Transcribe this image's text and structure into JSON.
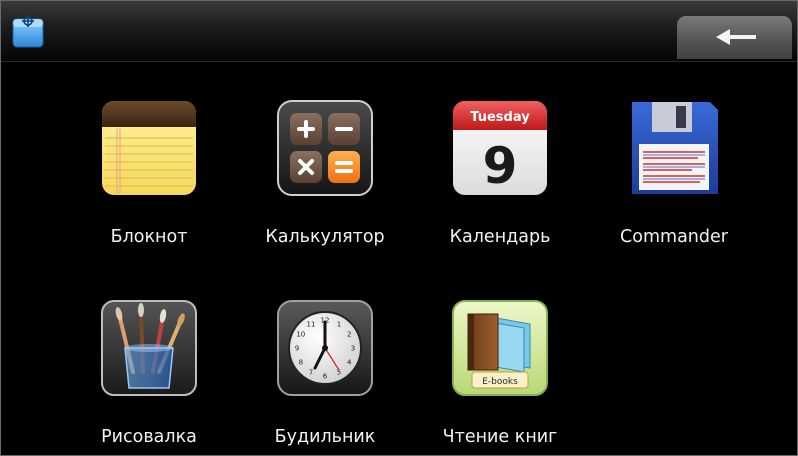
{
  "topbar": {
    "status_icon": "ship-wheel-icon",
    "back_icon": "back-arrow-icon"
  },
  "apps": [
    {
      "label": "Блокнот",
      "icon": "notepad-icon"
    },
    {
      "label": "Калькулятор",
      "icon": "calculator-icon"
    },
    {
      "label": "Календарь",
      "icon": "calendar-icon",
      "weekday": "Tuesday",
      "day": "9"
    },
    {
      "label": "Commander",
      "icon": "floppy-disk-icon"
    },
    {
      "label": "Рисовалка",
      "icon": "paint-brushes-icon"
    },
    {
      "label": "Будильник",
      "icon": "alarm-clock-icon",
      "clock_numbers": [
        "12",
        "1",
        "2",
        "3",
        "4",
        "5",
        "6",
        "7",
        "8",
        "9",
        "10",
        "11"
      ]
    },
    {
      "label": "Чтение книг",
      "icon": "ebooks-icon",
      "badge": "E-books"
    }
  ],
  "colors": {
    "background": "#000000",
    "label": "#f2f2f2",
    "accent_orange": "#ff8a1e",
    "calendar_red": "#d93a3a"
  }
}
